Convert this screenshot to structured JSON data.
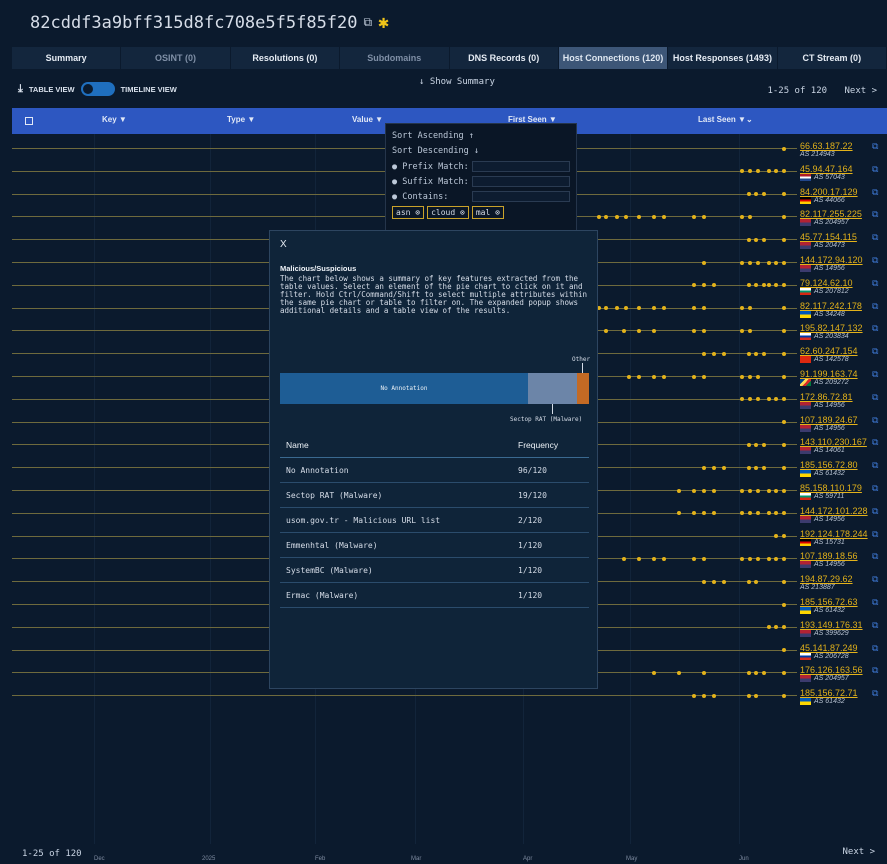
{
  "header": {
    "hash": "82cddf3a9bff315d8fc708e5f5f85f20"
  },
  "tabs": [
    {
      "label": "Summary",
      "dim": false,
      "active": false
    },
    {
      "label": "OSINT (0)",
      "dim": true,
      "active": false
    },
    {
      "label": "Resolutions (0)",
      "dim": false,
      "active": false
    },
    {
      "label": "Subdomains",
      "dim": true,
      "active": false
    },
    {
      "label": "DNS Records (0)",
      "dim": false,
      "active": false
    },
    {
      "label": "Host Connections (120)",
      "dim": false,
      "active": true
    },
    {
      "label": "Host Responses (1493)",
      "dim": false,
      "active": false
    },
    {
      "label": "CT Stream (0)",
      "dim": false,
      "active": false
    }
  ],
  "toolbar": {
    "table_view": "TABLE VIEW",
    "timeline_view": "TIMELINE VIEW",
    "show_summary": "↓ Show Summary",
    "range": "1-25 of 120",
    "next": "Next >"
  },
  "columns": {
    "key": "Key",
    "type": "Type",
    "value": "Value",
    "first_seen": "First Seen",
    "last_seen": "Last Seen"
  },
  "filter_menu": {
    "sort_asc": "Sort Ascending ↑",
    "sort_desc": "Sort Descending ↓",
    "prefix": "Prefix Match:",
    "suffix": "Suffix Match:",
    "contains": "Contains:",
    "chips": [
      "asn",
      "cloud",
      "mal"
    ]
  },
  "rows": [
    {
      "ip": "66.63.187.22",
      "asn": "AS 214943",
      "flag": ""
    },
    {
      "ip": "45.94.47.164",
      "asn": "AS 57043",
      "flag": "nl"
    },
    {
      "ip": "84.200.17.129",
      "asn": "AS 44066",
      "flag": "de"
    },
    {
      "ip": "82.117.255.225",
      "asn": "AS 204957",
      "flag": "us"
    },
    {
      "ip": "45.77.154.115",
      "asn": "AS 20473",
      "flag": "us"
    },
    {
      "ip": "144.172.94.120",
      "asn": "AS 14956",
      "flag": "us"
    },
    {
      "ip": "79.124.62.10",
      "asn": "AS 207812",
      "flag": "bg"
    },
    {
      "ip": "82.117.242.178",
      "asn": "AS 34248",
      "flag": "ua"
    },
    {
      "ip": "195.82.147.132",
      "asn": "AS 203834",
      "flag": "ru"
    },
    {
      "ip": "62.60.247.154",
      "asn": "AS 142578",
      "flag": "hk"
    },
    {
      "ip": "91.199.163.74",
      "asn": "AS 209272",
      "flag": "sc"
    },
    {
      "ip": "172.86.72.81",
      "asn": "AS 14956",
      "flag": "us"
    },
    {
      "ip": "107.189.24.67",
      "asn": "AS 14956",
      "flag": "us"
    },
    {
      "ip": "143.110.230.167",
      "asn": "AS 14061",
      "flag": "us"
    },
    {
      "ip": "185.156.72.80",
      "asn": "AS 61432",
      "flag": "ua"
    },
    {
      "ip": "85.158.110.179",
      "asn": "AS 59711",
      "flag": "bg"
    },
    {
      "ip": "144.172.101.228",
      "asn": "AS 14956",
      "flag": "us"
    },
    {
      "ip": "192.124.178.244",
      "asn": "AS 15731",
      "flag": "de"
    },
    {
      "ip": "107.189.18.56",
      "asn": "AS 14956",
      "flag": "us"
    },
    {
      "ip": "194.87.29.62",
      "asn": "AS 213887",
      "flag": ""
    },
    {
      "ip": "185.156.72.63",
      "asn": "AS 61432",
      "flag": "ua"
    },
    {
      "ip": "193.149.176.31",
      "asn": "AS 399629",
      "flag": "us"
    },
    {
      "ip": "45.141.87.249",
      "asn": "AS 206728",
      "flag": "ru"
    },
    {
      "ip": "176.126.163.56",
      "asn": "AS 204957",
      "flag": "us"
    },
    {
      "ip": "185.156.72.71",
      "asn": "AS 61432",
      "flag": "ua"
    }
  ],
  "months": [
    "Dec",
    "2025",
    "Feb",
    "Mar",
    "Apr",
    "May",
    "Jun"
  ],
  "modal": {
    "close": "X",
    "title": "Malicious/Suspicious",
    "description": "The chart below shows a summary of key features extracted from the table values. Select an element of the pie chart to click on it and filter. Hold Ctrl/Command/Shift to select multiple attributes within the same pie chart or table to filter on. The expanded popup shows additional details and a table view of the results.",
    "bar_label": "No Annotation",
    "other_label": "Other",
    "sectop_label": "Sectop RAT (Malware)",
    "table_headers": {
      "name": "Name",
      "freq": "Frequency"
    },
    "table": [
      {
        "name": "No Annotation",
        "freq": "96/120"
      },
      {
        "name": "Sectop RAT (Malware)",
        "freq": "19/120"
      },
      {
        "name": "usom.gov.tr - Malicious URL list",
        "freq": "2/120"
      },
      {
        "name": "Emmenhtal (Malware)",
        "freq": "1/120"
      },
      {
        "name": "SystemBC (Malware)",
        "freq": "1/120"
      },
      {
        "name": "Ermac (Malware)",
        "freq": "1/120"
      }
    ]
  },
  "colors": {
    "accent": "#2d57c1",
    "gold": "#e3b21a",
    "panel": "#0f2439"
  }
}
